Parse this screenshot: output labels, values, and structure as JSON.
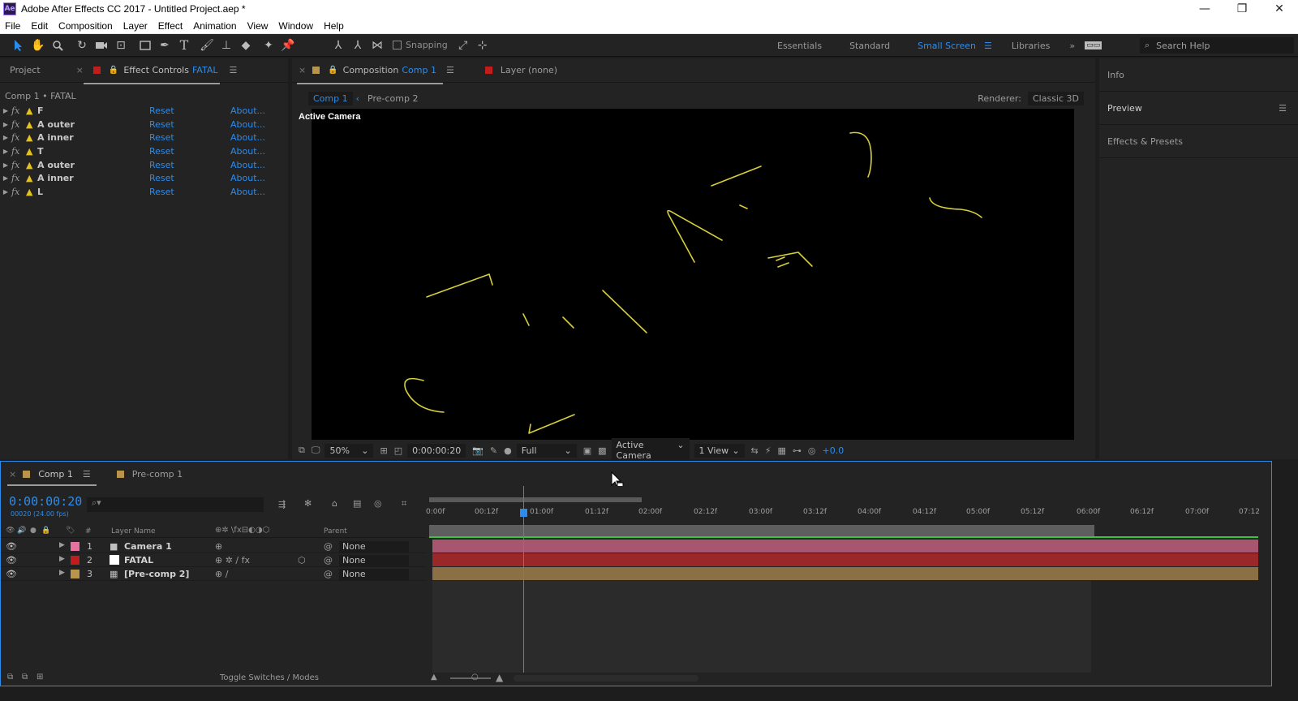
{
  "window": {
    "app_icon": "Ae",
    "title": "Adobe After Effects CC 2017 - Untitled Project.aep *",
    "controls": [
      "—",
      "❐",
      "✕"
    ]
  },
  "menu": [
    "File",
    "Edit",
    "Composition",
    "Layer",
    "Effect",
    "Animation",
    "View",
    "Window",
    "Help"
  ],
  "toolbar": {
    "snapping_label": "Snapping",
    "workspaces": [
      "Essentials",
      "Standard",
      "Small Screen",
      "Libraries"
    ],
    "active_workspace": "Small Screen",
    "search_placeholder": "Search Help"
  },
  "project_panel": {
    "tab_project": "Project",
    "tab_effect_controls_prefix": "Effect Controls",
    "tab_effect_controls_layer": "FATAL",
    "breadcrumb": "Comp 1 • FATAL",
    "effects": [
      {
        "name": "F",
        "reset": "Reset",
        "about": "About..."
      },
      {
        "name": "A outer",
        "reset": "Reset",
        "about": "About..."
      },
      {
        "name": "A inner",
        "reset": "Reset",
        "about": "About..."
      },
      {
        "name": "T",
        "reset": "Reset",
        "about": "About..."
      },
      {
        "name": "A outer",
        "reset": "Reset",
        "about": "About..."
      },
      {
        "name": "A inner",
        "reset": "Reset",
        "about": "About..."
      },
      {
        "name": "L",
        "reset": "Reset",
        "about": "About..."
      }
    ]
  },
  "composition_panel": {
    "tab_prefix": "Composition",
    "tab_comp": "Comp 1",
    "tab_layer": "Layer (none)",
    "sub_tabs": [
      "Comp 1",
      "Pre-comp 2"
    ],
    "renderer_label": "Renderer:",
    "renderer_value": "Classic 3D",
    "view_label": "Active Camera",
    "zoom": "50%",
    "timecode": "0:00:00:20",
    "resolution": "Full",
    "camera": "Active Camera",
    "views": "1 View",
    "exposure": "+0.0"
  },
  "right_panels": [
    "Info",
    "Preview",
    "Effects & Presets"
  ],
  "timeline": {
    "tabs": [
      "Comp 1",
      "Pre-comp 1"
    ],
    "timecode": "0:00:00:20",
    "fps": "00020 (24.00 fps)",
    "search_placeholder": "⌕▾",
    "columns": {
      "number": "#",
      "layer_name": "Layer Name",
      "parent": "Parent"
    },
    "layers": [
      {
        "num": "1",
        "name": "Camera 1",
        "color": "#e6739f",
        "parent": "None"
      },
      {
        "num": "2",
        "name": "FATAL",
        "color": "#c21d1d",
        "parent": "None"
      },
      {
        "num": "3",
        "name": "[Pre-comp 2]",
        "color": "#b8954a",
        "parent": "None"
      }
    ],
    "ruler": [
      "0:00f",
      "00:12f",
      "01:00f",
      "01:12f",
      "02:00f",
      "02:12f",
      "03:00f",
      "03:12f",
      "04:00f",
      "04:12f",
      "05:00f",
      "05:12f",
      "06:00f",
      "06:12f",
      "07:00f",
      "07:12"
    ],
    "toggle_label": "Toggle Switches / Modes"
  },
  "colors": {
    "accent": "#2d8ceb",
    "stroke": "#d6cf3b",
    "camera_track": "#a8566f",
    "fatal_track": "#9b2828",
    "precomp_track": "#8a7044"
  }
}
